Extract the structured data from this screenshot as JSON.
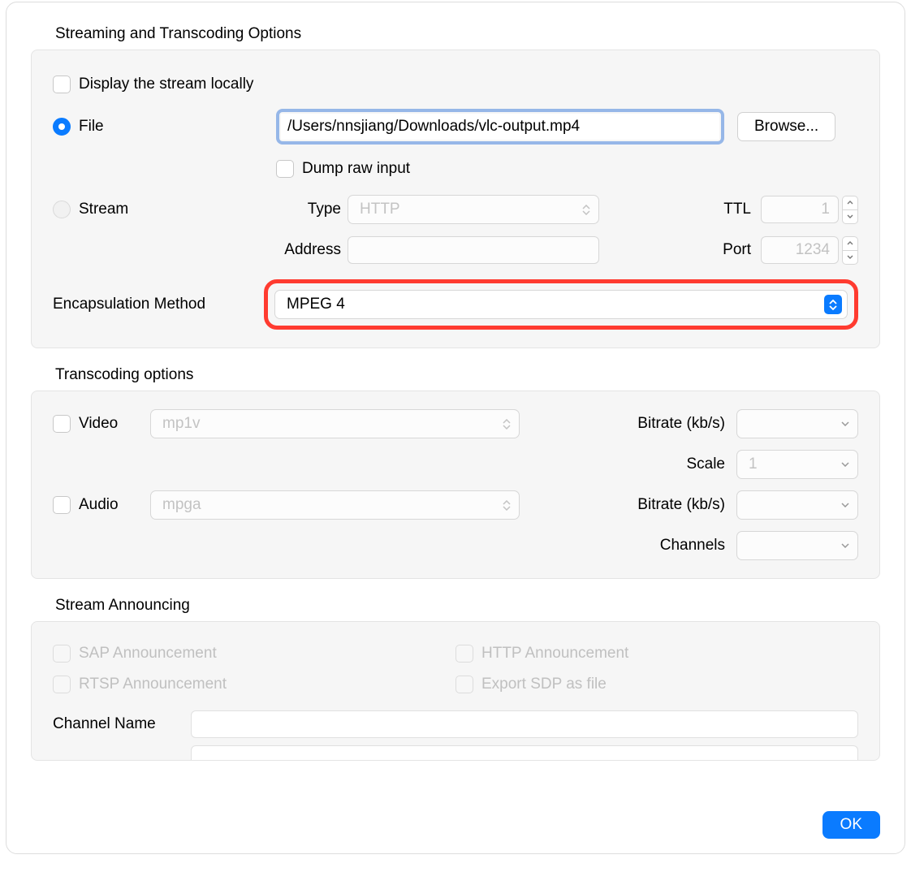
{
  "section1": {
    "title": "Streaming and Transcoding Options",
    "display_locally_label": "Display the stream locally",
    "file_label": "File",
    "file_path": "/Users/nnsjiang/Downloads/vlc-output.mp4",
    "browse_label": "Browse...",
    "dump_raw_label": "Dump raw input",
    "stream_label": "Stream",
    "type_label": "Type",
    "type_value": "HTTP",
    "ttl_label": "TTL",
    "ttl_value": "1",
    "address_label": "Address",
    "port_label": "Port",
    "port_value": "1234",
    "encap_label": "Encapsulation Method",
    "encap_value": "MPEG 4"
  },
  "section2": {
    "title": "Transcoding options",
    "video_label": "Video",
    "video_codec": "mp1v",
    "audio_label": "Audio",
    "audio_codec": "mpga",
    "bitrate_label": "Bitrate (kb/s)",
    "scale_label": "Scale",
    "scale_value": "1",
    "channels_label": "Channels"
  },
  "section3": {
    "title": "Stream Announcing",
    "sap_label": "SAP Announcement",
    "http_label": "HTTP Announcement",
    "rtsp_label": "RTSP Announcement",
    "export_sdp_label": "Export SDP as file",
    "channel_name_label": "Channel Name"
  },
  "footer": {
    "ok_label": "OK"
  }
}
